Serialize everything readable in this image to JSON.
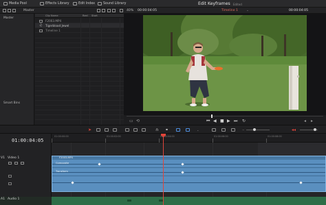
{
  "toolbar": {
    "media_pool": "Media Pool",
    "effects_library": "Effects Library",
    "edit_index": "Edit Index",
    "sound_library": "Sound Library",
    "page_title": "Edit Keyframes",
    "page_subtitle": "Edited"
  },
  "subbar": {
    "master": "Master",
    "zoom": "40%",
    "timecode": "00:00:04:05",
    "timeline_name": "Timeline 1"
  },
  "bins": {
    "master": "Master",
    "smart_bins": "Smart Bins"
  },
  "cliplist": {
    "col_name": "Clip Name",
    "col_reel": "Reel",
    "col_start": "Start",
    "rows": [
      "F2003.MP4",
      "Tigerblood Jewel",
      "Timeline 1"
    ]
  },
  "timeline": {
    "timecode": "01:00:04:05",
    "ruler_labels": [
      "01:00:00:00",
      "01:00:02:00",
      "01:00:04:00",
      "01:00:06:00",
      "01:00:08:00"
    ],
    "tracks": {
      "v1_tag": "V1",
      "v1_name": "Video 1",
      "a1_tag": "A1",
      "a1_name": "Audio 1"
    },
    "clip_name": "F2003.MP4",
    "kf_rows": [
      "Composite",
      "Transform"
    ]
  },
  "colors": {
    "accent": "#e0453a",
    "clip_blue": "#5a8fbf",
    "audio_green": "#2e6e48"
  }
}
